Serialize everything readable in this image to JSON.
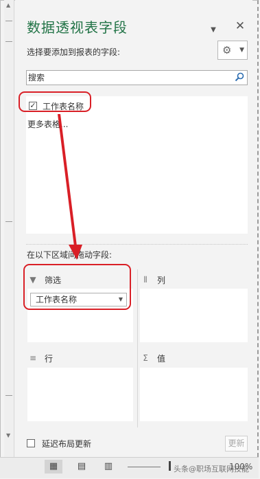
{
  "panel": {
    "title": "数据透视表字段",
    "choose_fields_label": "选择要添加到报表的字段:",
    "search": {
      "placeholder": "搜索",
      "value": ""
    }
  },
  "field_list": {
    "items": [
      {
        "label": "工作表名称",
        "checked": true
      }
    ],
    "more_tables_link": "更多表格..."
  },
  "areas": {
    "instruction": "在以下区域间拖动字段:",
    "filter": {
      "label": "筛选",
      "fields": [
        "工作表名称"
      ]
    },
    "columns": {
      "label": "列"
    },
    "rows": {
      "label": "行"
    },
    "values": {
      "label": "值"
    }
  },
  "footer": {
    "defer_label": "延迟布局更新",
    "defer_checked": false,
    "update_label": "更新"
  },
  "status_bar": {
    "watermark": "头条@职场互联网技能",
    "zoom": "100%"
  },
  "colors": {
    "title_green": "#217346",
    "highlight_red": "#d91f26"
  }
}
